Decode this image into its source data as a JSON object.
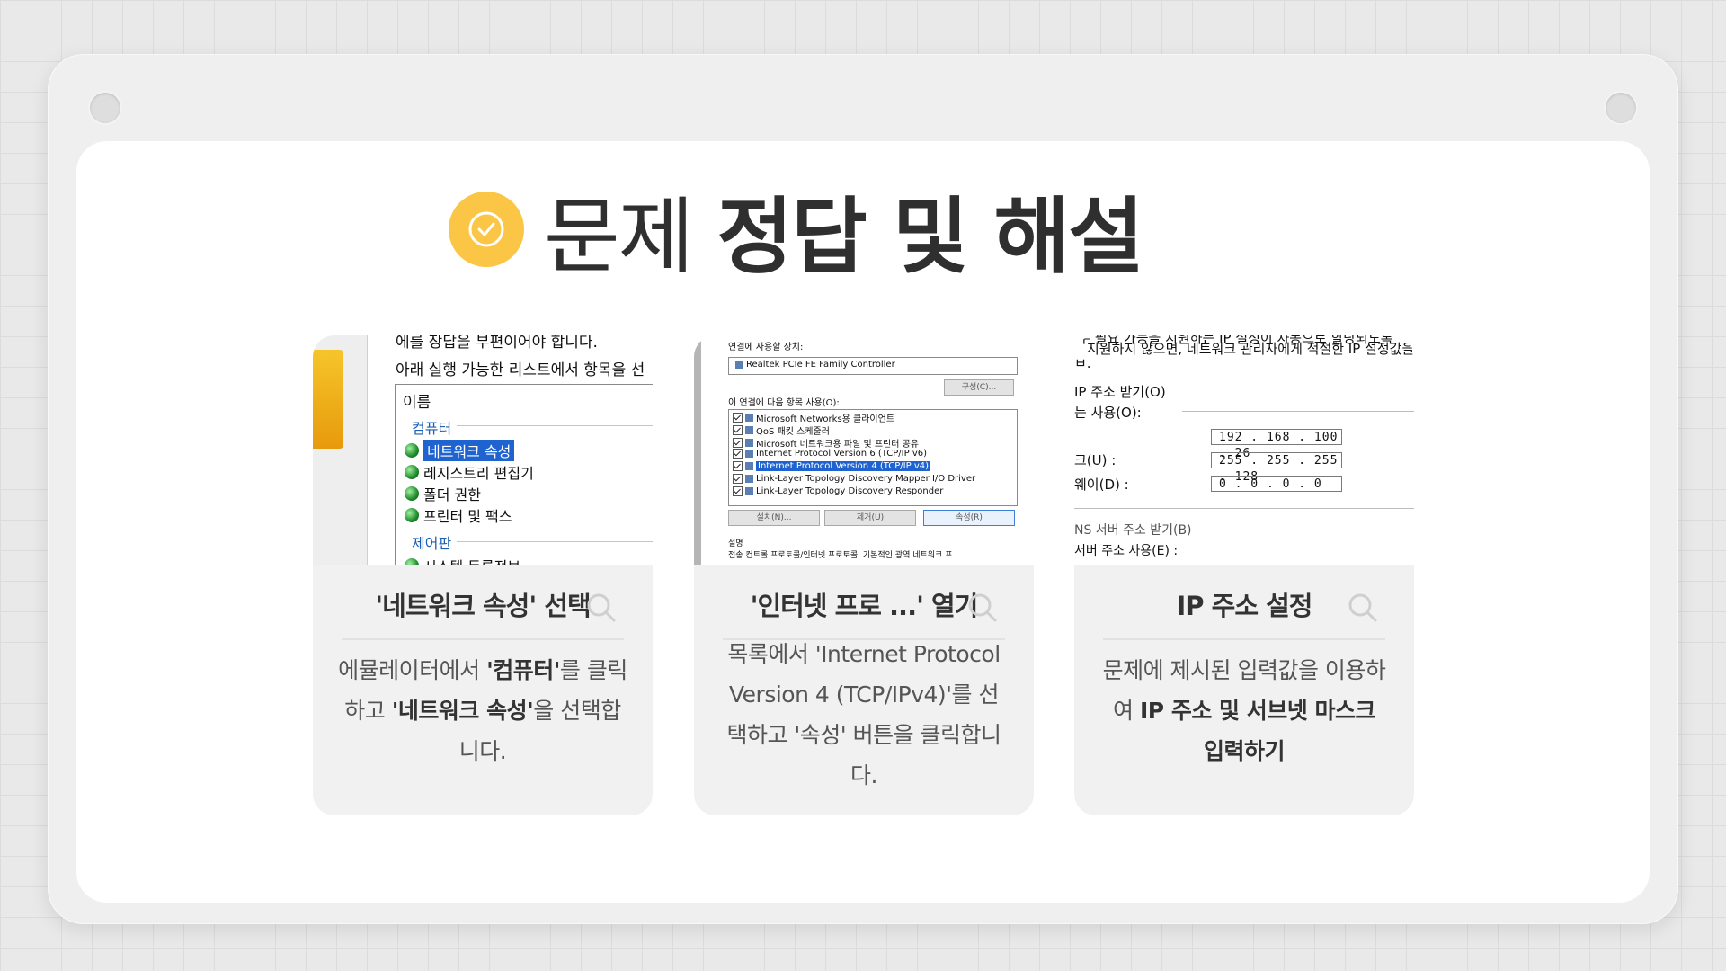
{
  "title": {
    "part1": "문제",
    "part2": "정답 및 해설"
  },
  "cards": [
    {
      "title": "'네트워크 속성' 선택",
      "desc_parts": [
        "에뮬레이터에서 ",
        "'컴퓨터'",
        "를 클릭하고 ",
        "'네트워크 속성'",
        "을 선택합니다."
      ],
      "screenshot": {
        "line1": "에를 장답을 부편이어야 합니다.",
        "line2": "아래 실행 가능한 리스트에서 항목을 선",
        "header": "이름",
        "group1": "컴퓨터",
        "items": [
          "네트워크 속성",
          "레지스트리 편집기",
          "폴더 권한",
          "프린터 및 팩스"
        ],
        "group2": "제어판",
        "item_partial": "시스템 등록정보"
      }
    },
    {
      "title": "'인터넷 프로 ...' 열기",
      "desc": "목록에서 'Internet Protocol Version 4 (TCP/IPv4)'를 선택하고 '속성' 버튼을 클릭합니다.",
      "screenshot": {
        "device_label": "연결에 사용할 장치:",
        "device_name": "Realtek PCIe FE Family Controller",
        "configure_button": "구성(C)...",
        "items_label": "이 연결에 다음 항목 사용(O):",
        "items": [
          "Microsoft Networks용 클라이언트",
          "QoS 패킷 스케줄러",
          "Microsoft 네트워크용 파일 및 프린터 공유",
          "Internet Protocol Version 6 (TCP/IP v6)",
          "Internet Protocol Version 4 (TCP/IP v4)",
          "Link-Layer Topology Discovery Mapper I/O Driver",
          "Link-Layer Topology Discovery Responder"
        ],
        "install_button": "설치(N)...",
        "remove_button": "제거(U)",
        "properties_button": "속성(R)",
        "desc_label": "설명",
        "desc_text": "전송 컨트롤 프로토콜/인터넷 프로토콜. 기본적인 광역 네트워크 프"
      }
    },
    {
      "title": "IP 주소 설정",
      "desc_parts": [
        "문제에 제시된 입력값을 이용하여 ",
        "IP 주소 및 서브넷 마스크 입력하기"
      ],
      "screenshot": {
        "line1": "우 필요 가능을 지원하는 IP 설정이 자동으로 할당되도록",
        "line2": "지원하지 않으면, 네트워크 관리자에게 적절한 IP 설정값을",
        "line3": "ㅂ.",
        "auto_ip": "IP 주소 받기(O)",
        "use_ip": "는 사용(O):",
        "ip_label": "",
        "ip_value": "192 . 168 . 100 .  26",
        "mask_label": "크(U) :",
        "mask_value": "255 . 255 . 255 . 128",
        "gw_label": "웨이(D) :",
        "gw_value": "  0 .   0 .   0 .   0",
        "dns_auto": "NS 서버 주소 받기(B)",
        "dns_use": "서버 주소 사용(E) :"
      }
    }
  ]
}
